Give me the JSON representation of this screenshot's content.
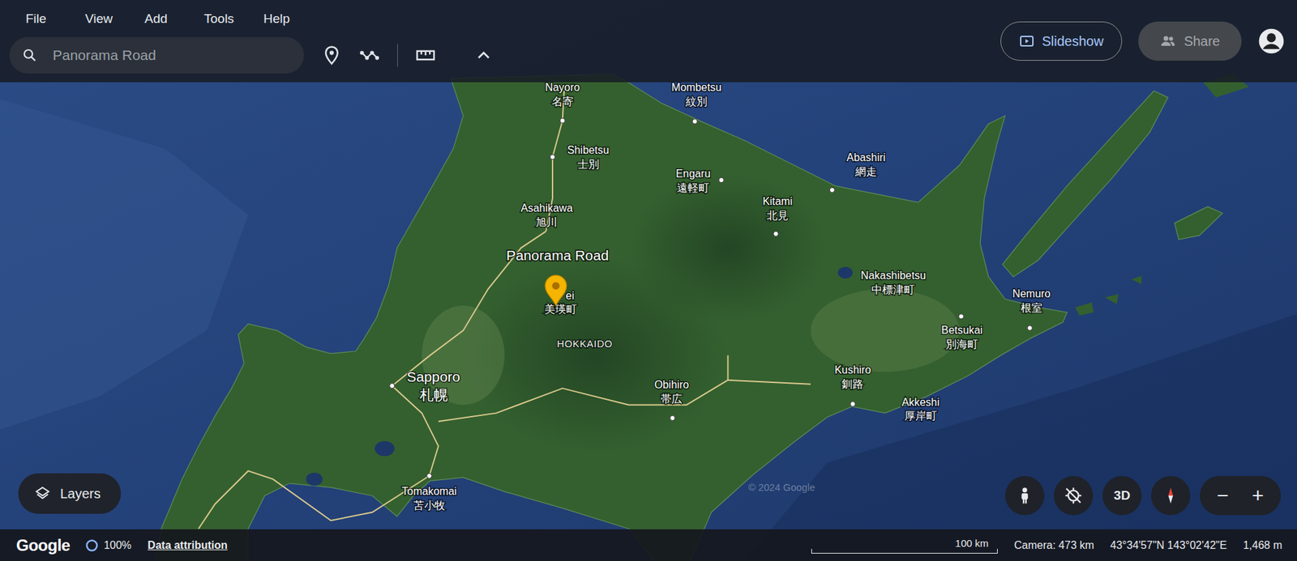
{
  "menu": [
    "File",
    "View",
    "Add",
    "Tools",
    "Help"
  ],
  "search": {
    "value": "Panorama Road"
  },
  "toolbar": {
    "slideshow": "Slideshow",
    "share": {
      "label": "Share",
      "disabled": true
    }
  },
  "map": {
    "place": "Panorama Road",
    "region": "HOKKAIDO",
    "watermark": "© 2024 Google",
    "labels": [
      {
        "name": "Nayoro",
        "native": "名寄",
        "kind": "town"
      },
      {
        "name": "Mombetsu",
        "native": "紋別",
        "kind": "town"
      },
      {
        "name": "Shibetsu",
        "native": "士別",
        "kind": "town"
      },
      {
        "name": "Engaru",
        "native": "遠軽町",
        "kind": "town"
      },
      {
        "name": "Abashiri",
        "native": "網走",
        "kind": "town"
      },
      {
        "name": "Asahikawa",
        "native": "旭川",
        "kind": "city"
      },
      {
        "name": "Kitami",
        "native": "北見",
        "kind": "town"
      },
      {
        "name": "ei",
        "native": "美瑛町",
        "kind": "town"
      },
      {
        "name": "Nakashibetsu",
        "native": "中標津町",
        "kind": "town"
      },
      {
        "name": "Nemuro",
        "native": "根室",
        "kind": "town"
      },
      {
        "name": "Betsukai",
        "native": "別海町",
        "kind": "town"
      },
      {
        "name": "Kushiro",
        "native": "釧路",
        "kind": "town"
      },
      {
        "name": "Akkeshi",
        "native": "厚岸町",
        "kind": "town"
      },
      {
        "name": "Sapporo",
        "native": "札幌",
        "kind": "major"
      },
      {
        "name": "Obihiro",
        "native": "帯広",
        "kind": "town"
      },
      {
        "name": "Tomakomai",
        "native": "苫小牧",
        "kind": "town"
      }
    ]
  },
  "controls": {
    "layers": "Layers",
    "view_mode": "3D",
    "zoom_out": "−",
    "zoom_in": "+"
  },
  "status_bar": {
    "logo": "Google",
    "loading": "100%",
    "attribution": "Data attribution",
    "scale": "100 km",
    "camera": "Camera: 473 km",
    "coordinates": "43°34'57\"N 143°02'42\"E",
    "elevation": "1,468 m"
  }
}
